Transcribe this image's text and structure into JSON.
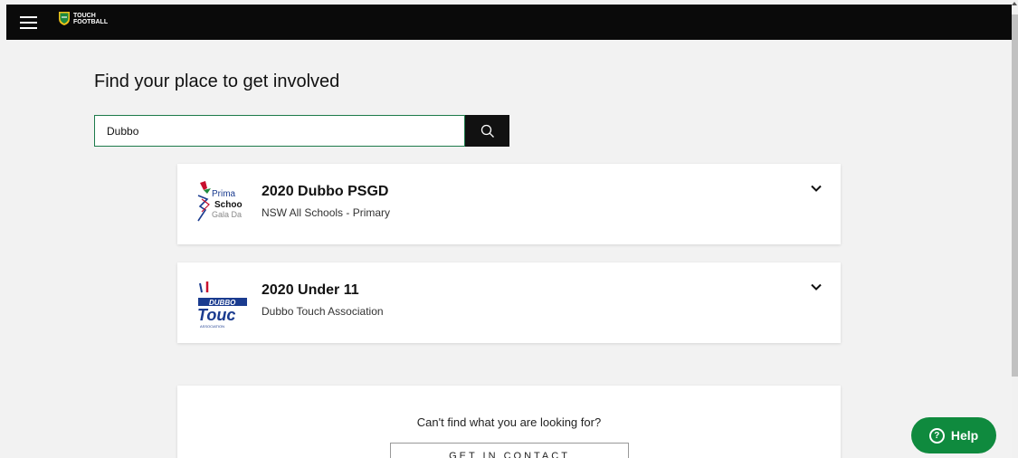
{
  "header": {
    "menu_icon": "hamburger-icon",
    "logo_text_line1": "TOUCH",
    "logo_text_line2": "FOOTBALL"
  },
  "main": {
    "title": "Find your place to get involved",
    "search": {
      "value": "Dubbo",
      "placeholder": "",
      "button_icon": "search-icon"
    },
    "results": [
      {
        "title": "2020 Dubbo PSGD",
        "subtitle": "NSW All Schools - Primary",
        "logo_text": [
          "Prima",
          "Schoo",
          "Gala Da"
        ]
      },
      {
        "title": "2020 Under 11",
        "subtitle": "Dubbo Touch Association",
        "logo_text": [
          "DUBBO",
          "Touc",
          "ASSOCIATION"
        ]
      }
    ],
    "contact": {
      "prompt": "Can't find what you are looking for?",
      "button_label": "GET IN CONTACT"
    }
  },
  "help": {
    "label": "Help",
    "icon": "question-circle-icon"
  },
  "colors": {
    "topbar": "#0a0a0a",
    "accent_green": "#0f8a3e",
    "search_border": "#1d7a4a",
    "page_bg": "#f2f2f2"
  }
}
